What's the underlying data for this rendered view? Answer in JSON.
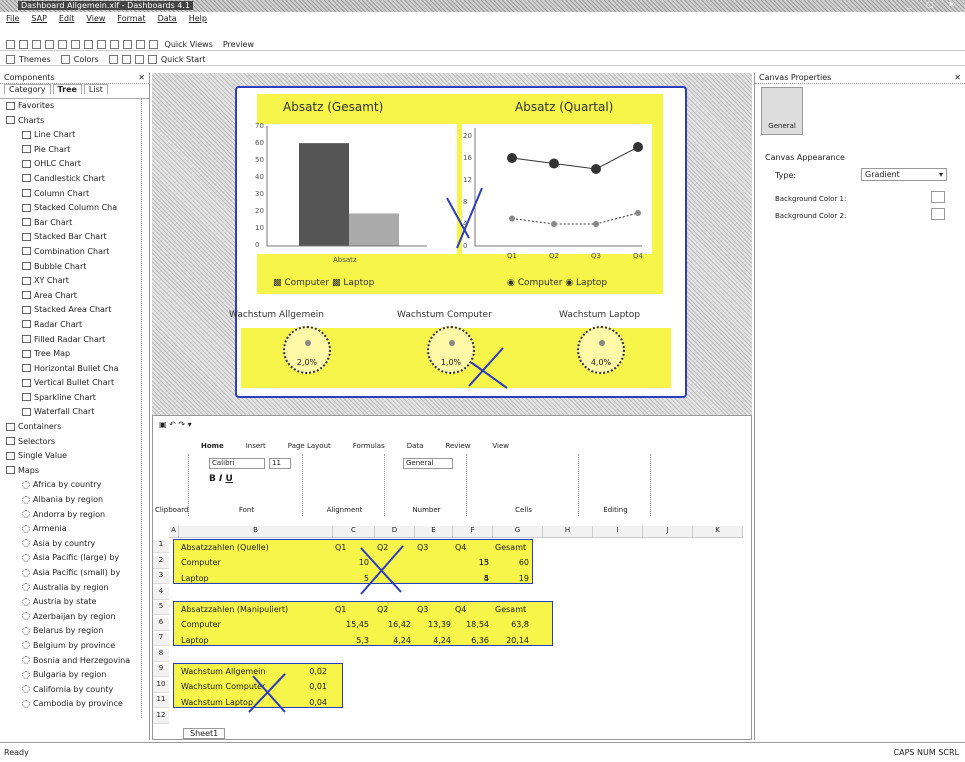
{
  "window": {
    "title": "Dashboard Allgemein.xlf - Dashboards 4.1"
  },
  "menu": [
    "File",
    "SAP",
    "Edit",
    "View",
    "Format",
    "Data",
    "Help"
  ],
  "toolbar2": {
    "quick_views": "Quick Views",
    "preview": "Preview"
  },
  "toolbar3": {
    "themes": "Themes",
    "colors": "Colors",
    "quick_start": "Quick Start"
  },
  "components": {
    "title": "Components",
    "tabs": [
      "Category",
      "Tree",
      "List"
    ],
    "items": [
      "Favorites",
      "Charts",
      "Line Chart",
      "Pie Chart",
      "OHLC Chart",
      "Candlestick Chart",
      "Column Chart",
      "Stacked Column Cha",
      "Bar Chart",
      "Stacked Bar Chart",
      "Combination Chart",
      "Bubble Chart",
      "XY Chart",
      "Area Chart",
      "Stacked Area Chart",
      "Radar Chart",
      "Filled Radar Chart",
      "Tree Map",
      "Horizontal Bullet Cha",
      "Vertical Bullet Chart",
      "Sparkline Chart",
      "Waterfall Chart",
      "Containers",
      "Selectors",
      "Single Value",
      "Maps",
      "Africa by country",
      "Albania by region",
      "Andorra by region",
      "Armenia",
      "Asia by country",
      "Asia Pacific (large) by",
      "Asia Pacific (small) by",
      "Australia by region",
      "Austria by state",
      "Azerbaijan by region",
      "Belarus by region",
      "Belgium by province",
      "Bosnia and Herzegovina",
      "Bulgaria by region",
      "California by county",
      "Cambodia by province"
    ]
  },
  "dashboard": {
    "chart1_title": "Absatz (Gesamt)",
    "chart2_title": "Absatz (Quartal)",
    "chart1_y_ticks": [
      "70",
      "60",
      "50",
      "40",
      "30",
      "20",
      "10",
      "0"
    ],
    "chart2_y_ticks": [
      "20",
      "16",
      "12",
      "8",
      "4",
      "0"
    ],
    "chart1_x": "Absatz",
    "legend": [
      "Computer",
      "Laptop"
    ],
    "gauge_titles": [
      "Wachstum Allgemein",
      "Wachstum Computer",
      "Wachstum Laptop"
    ],
    "gauge_values": [
      "2,0%",
      "1,0%",
      "4,0%"
    ]
  },
  "chart_data": [
    {
      "type": "bar",
      "title": "Absatz (Gesamt)",
      "categories": [
        "Absatz"
      ],
      "series": [
        {
          "name": "Computer",
          "values": [
            60
          ]
        },
        {
          "name": "Laptop",
          "values": [
            19
          ]
        }
      ],
      "ylim": [
        0,
        70
      ]
    },
    {
      "type": "line",
      "title": "Absatz (Quartal)",
      "categories": [
        "Q1",
        "Q2",
        "Q3",
        "Q4"
      ],
      "series": [
        {
          "name": "Computer",
          "values": [
            16,
            15,
            14,
            18
          ]
        },
        {
          "name": "Laptop",
          "values": [
            5,
            4,
            4,
            6
          ]
        }
      ],
      "ylim": [
        0,
        20
      ]
    }
  ],
  "properties": {
    "title": "Canvas Properties",
    "tab": "General",
    "section": "Canvas Appearance",
    "type_label": "Type:",
    "type_value": "Gradient",
    "bg1": "Background Color 1:",
    "bg2": "Background Color 2:"
  },
  "excel": {
    "ribbon_tabs": [
      "Home",
      "Insert",
      "Page Layout",
      "Formulas",
      "Data",
      "Review",
      "View"
    ],
    "font": "Calibri",
    "size": "11",
    "format": "General",
    "groups": [
      "Clipboard",
      "Font",
      "Alignment",
      "Number",
      "Cells",
      "Editing"
    ],
    "columns": [
      "A",
      "B",
      "C",
      "D",
      "E",
      "F",
      "G",
      "H",
      "I",
      "J",
      "K"
    ],
    "rows": [
      [
        "Absatzzahlen (Quelle)",
        "Q1",
        "Q2",
        "Q3",
        "Q4",
        "Gesamt"
      ],
      [
        "Computer",
        "10",
        "",
        "",
        "13",
        "15",
        "60"
      ],
      [
        "Laptop",
        "5",
        "",
        "",
        "4",
        "5",
        "19"
      ],
      [
        "",
        "",
        "",
        "",
        "",
        "",
        ""
      ],
      [
        "Absatzzahlen (Manipuliert)",
        "Q1",
        "Q2",
        "Q3",
        "Q4",
        "Gesamt"
      ],
      [
        "Computer",
        "15,45",
        "16,42",
        "13,39",
        "18,54",
        "63,8"
      ],
      [
        "Laptop",
        "5,3",
        "4,24",
        "4,24",
        "6,36",
        "20,14"
      ],
      [
        "",
        "",
        "",
        "",
        "",
        "",
        ""
      ],
      [
        "Wachstum Allgemein",
        "0,02"
      ],
      [
        "Wachstum Computer",
        "0,01"
      ],
      [
        "Wachstum Laptop",
        "0,04"
      ]
    ],
    "sheet_tab": "Sheet1"
  },
  "status": {
    "left": "Ready",
    "right": "CAPS NUM SCRL"
  }
}
